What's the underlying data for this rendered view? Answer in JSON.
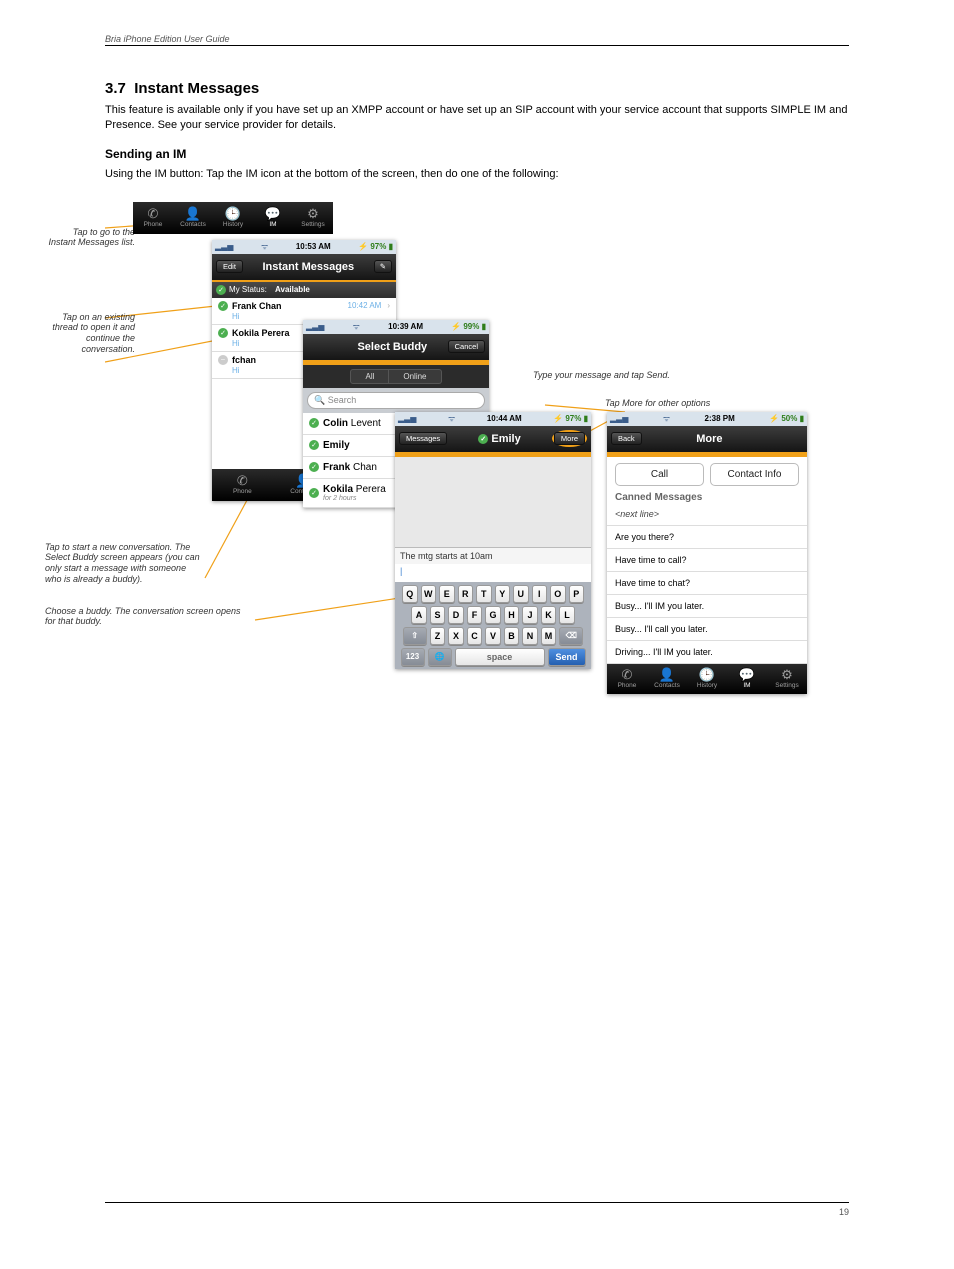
{
  "doc": {
    "header_left": "Bria iPhone Edition User Guide",
    "header_right": "",
    "footer_left": "",
    "footer_right": "19",
    "section_num": "3.7",
    "section_title": "Instant Messages",
    "intro": "This feature is available only if you have set up an XMPP account or have set up an SIP account with your service account that supports SIMPLE IM and Presence. See your service provider for details.",
    "sub1": "Sending an IM",
    "sub1_text": "Using the IM button: Tap the IM icon at the bottom of the screen, then do one of the following:"
  },
  "callouts": {
    "c1": "Tap to go to the Instant Messages list.",
    "c2": "Tap on an existing thread to open it and continue the conversation.",
    "c3": "Tap to start a new conversation. The Select Buddy screen appears (you can only start a message with someone who is already a buddy).",
    "c4": "Choose a buddy. The conversation screen opens for that buddy.",
    "c5": "Type your message and tap Send.",
    "c6": "Tap More for other options"
  },
  "tabs": {
    "t1": "Phone",
    "t2": "Contacts",
    "t3": "History",
    "t4": "IM",
    "t5": "Settings"
  },
  "im": {
    "time": "10:53 AM",
    "battery": "97%",
    "edit": "Edit",
    "title": "Instant Messages",
    "status_label": "My Status:",
    "status_value": "Available",
    "th1_name": "Frank Chan",
    "th1_snip": "Hi",
    "th1_ts": "10:42 AM",
    "th2_name": "Kokila Perera",
    "th2_snip": "Hi",
    "th3_name": "fchan",
    "th3_snip": "Hi"
  },
  "sb": {
    "time": "10:39 AM",
    "battery": "99%",
    "title": "Select Buddy",
    "cancel": "Cancel",
    "seg_all": "All",
    "seg_online": "Online",
    "search_ph": "Search",
    "b1_first": "Colin",
    "b1_last": "Levent",
    "b2_first": "Emily",
    "b3_first": "Frank",
    "b3_last": "Chan",
    "b4_first": "Kokila",
    "b4_last": "Perera",
    "b4_sub": "for 2 hours"
  },
  "conv": {
    "time": "10:44 AM",
    "battery": "97%",
    "messages": "Messages",
    "buddy": "Emily",
    "more": "More",
    "draft": "The mtg starts at 10am",
    "keys_r1": [
      "Q",
      "W",
      "E",
      "R",
      "T",
      "Y",
      "U",
      "I",
      "O",
      "P"
    ],
    "keys_r2": [
      "A",
      "S",
      "D",
      "F",
      "G",
      "H",
      "J",
      "K",
      "L"
    ],
    "keys_r3": [
      "Z",
      "X",
      "C",
      "V",
      "B",
      "N",
      "M"
    ],
    "k_123": "123",
    "k_space": "space",
    "k_send": "Send"
  },
  "more": {
    "time": "2:38 PM",
    "battery": "50%",
    "back": "Back",
    "title": "More",
    "btn_call": "Call",
    "btn_info": "Contact Info",
    "canned_hdr": "Canned Messages",
    "cm": [
      "<next line>",
      "Are you there?",
      "Have time to call?",
      "Have time to chat?",
      "Busy... I'll IM you later.",
      "Busy... I'll call you later.",
      "Driving... I'll IM you later."
    ]
  }
}
